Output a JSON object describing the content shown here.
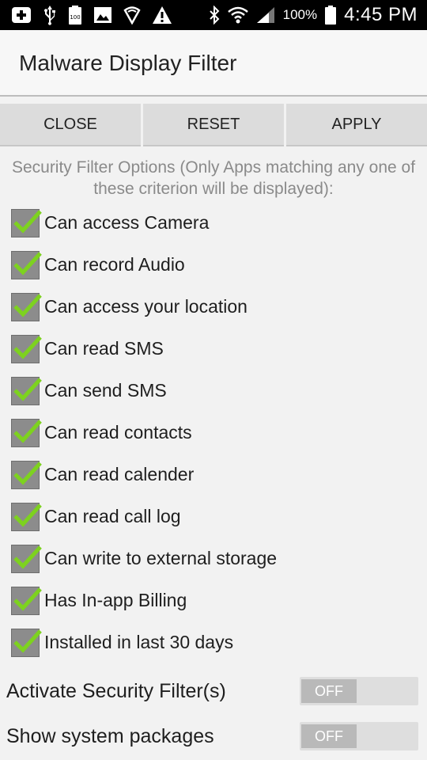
{
  "status_bar": {
    "battery_percent": "100%",
    "time": "4:45 PM",
    "icons": [
      "add-icon",
      "usb-icon",
      "battery-100-icon",
      "image-icon",
      "vpn-shield-icon",
      "warning-icon",
      "bluetooth-icon",
      "wifi-icon",
      "signal-icon",
      "battery-icon"
    ]
  },
  "header": {
    "title": "Malware Display Filter"
  },
  "toolbar": {
    "close_label": "CLOSE",
    "reset_label": "RESET",
    "apply_label": "APPLY"
  },
  "filters": {
    "description": "Security Filter Options (Only Apps matching any one of these criterion will be displayed):",
    "items": [
      {
        "label": "Can access Camera",
        "checked": true
      },
      {
        "label": "Can record Audio",
        "checked": true
      },
      {
        "label": "Can access your location",
        "checked": true
      },
      {
        "label": "Can read SMS",
        "checked": true
      },
      {
        "label": "Can send SMS",
        "checked": true
      },
      {
        "label": "Can read contacts",
        "checked": true
      },
      {
        "label": "Can read calender",
        "checked": true
      },
      {
        "label": "Can read call log",
        "checked": true
      },
      {
        "label": "Can write to external storage",
        "checked": true
      },
      {
        "label": "Has In-app Billing",
        "checked": true
      },
      {
        "label": "Installed in last 30 days",
        "checked": true
      }
    ]
  },
  "toggles": {
    "activate": {
      "label": "Activate Security Filter(s)",
      "state": "OFF"
    },
    "system": {
      "label": "Show system packages",
      "state": "OFF"
    }
  },
  "colors": {
    "check": "#7dd21f",
    "checkbox_bg": "#8c8c8c",
    "switch_track": "#dedede",
    "switch_knob": "#b9b9b9"
  }
}
